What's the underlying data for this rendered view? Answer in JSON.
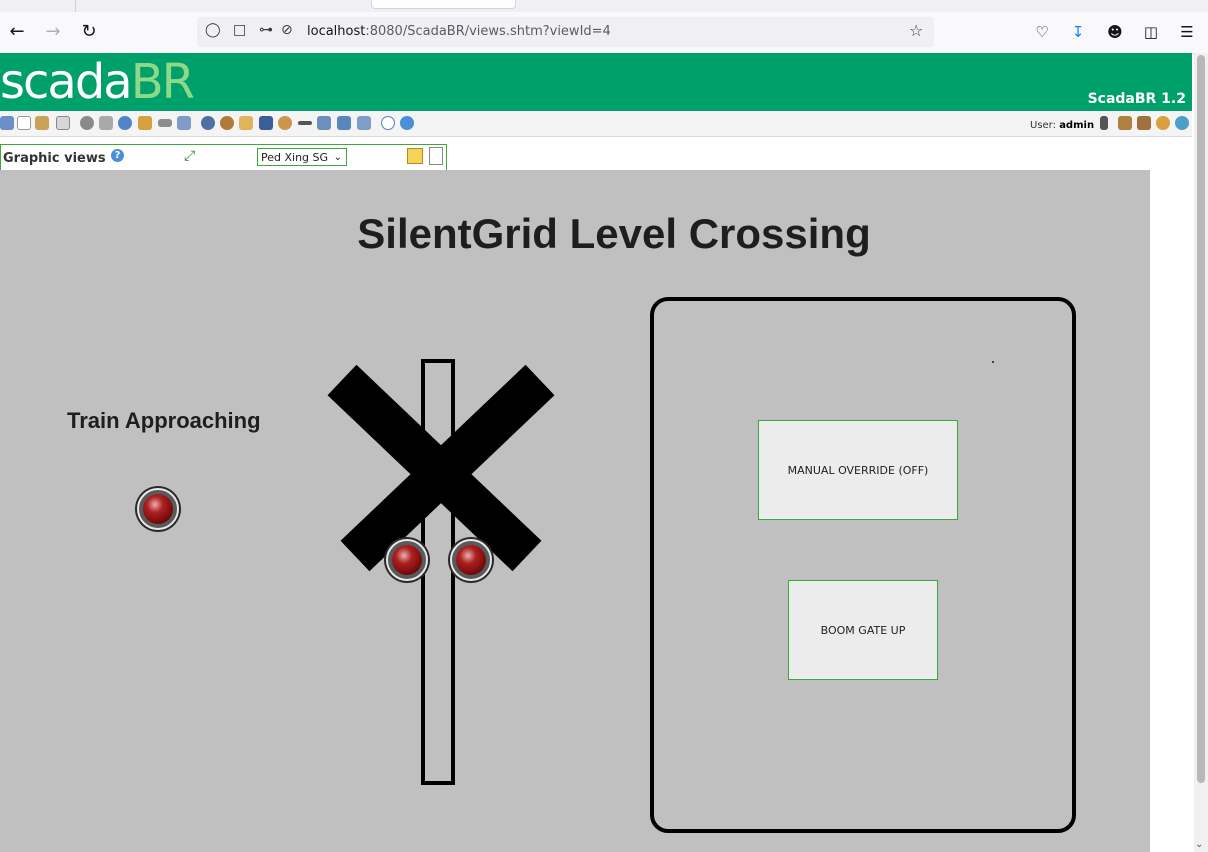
{
  "browser": {
    "url_host": "localhost",
    "url_rest": ":8080/ScadaBR/views.shtm?viewId=4"
  },
  "header": {
    "logo_part1": "scada",
    "logo_part2": "BR",
    "version": "ScadaBR 1.2"
  },
  "user": {
    "prefix": "User:",
    "name": "admin"
  },
  "graphic_views": {
    "title": "Graphic views",
    "selected_view": "Ped Xing SG"
  },
  "view": {
    "title": "SilentGrid Level Crossing",
    "train_label": "Train Approaching",
    "manual_override_label": "MANUAL OVERRIDE (OFF)",
    "boom_gate_label": "BOOM GATE UP"
  },
  "colors": {
    "header_green": "#00a06a",
    "canvas_gray": "#c0c0c0",
    "led_off_red": "#8b0000"
  }
}
